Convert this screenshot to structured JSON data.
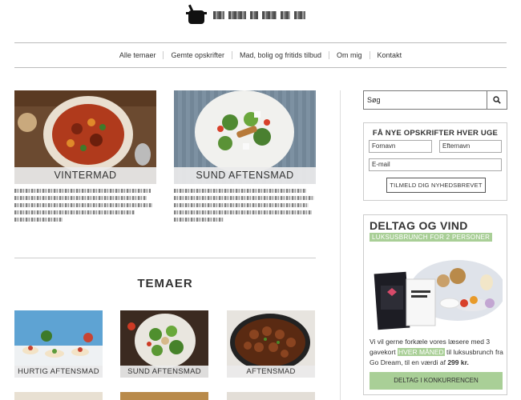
{
  "header": {
    "logo_alt": "pot-logo"
  },
  "nav": {
    "items": [
      "Alle temaer",
      "Gemte opskrifter",
      "Mad, bolig og fritids tilbud",
      "Om mig",
      "Kontakt"
    ]
  },
  "features": [
    {
      "caption": "VINTERMAD"
    },
    {
      "caption": "SUND AFTENSMAD"
    }
  ],
  "themes_section": {
    "title": "TEMAER",
    "items": [
      {
        "caption": "HURTIG AFTENSMAD"
      },
      {
        "caption": "SUND AFTENSMAD"
      },
      {
        "caption": "AFTENSMAD"
      }
    ]
  },
  "sidebar": {
    "search": {
      "placeholder": "Søg",
      "icon": "search-icon"
    },
    "newsletter": {
      "title": "FÅ NYE OPSKRIFTER HVER UGE",
      "first_name": "Fornavn",
      "last_name": "Efternavn",
      "email": "E-mail",
      "button": "TILMELD DIG NYHEDSBREVET"
    },
    "promo": {
      "title": "DELTAG OG VIND",
      "badge": "LUKSUSBRUNCH FOR 2 PERSONER",
      "text_1": "Vi vil gerne forkæle vores læsere med 3 gavekort",
      "highlight": "HVER MÅNED",
      "text_2": "til luksusbrunch fra Go Dream, til en værdi af",
      "price": "299 kr.",
      "cta": "DELTAG I KONKURRENCEN"
    }
  },
  "colors": {
    "accent_green": "#a9cf97",
    "nav_border": "#bbbbbb"
  }
}
